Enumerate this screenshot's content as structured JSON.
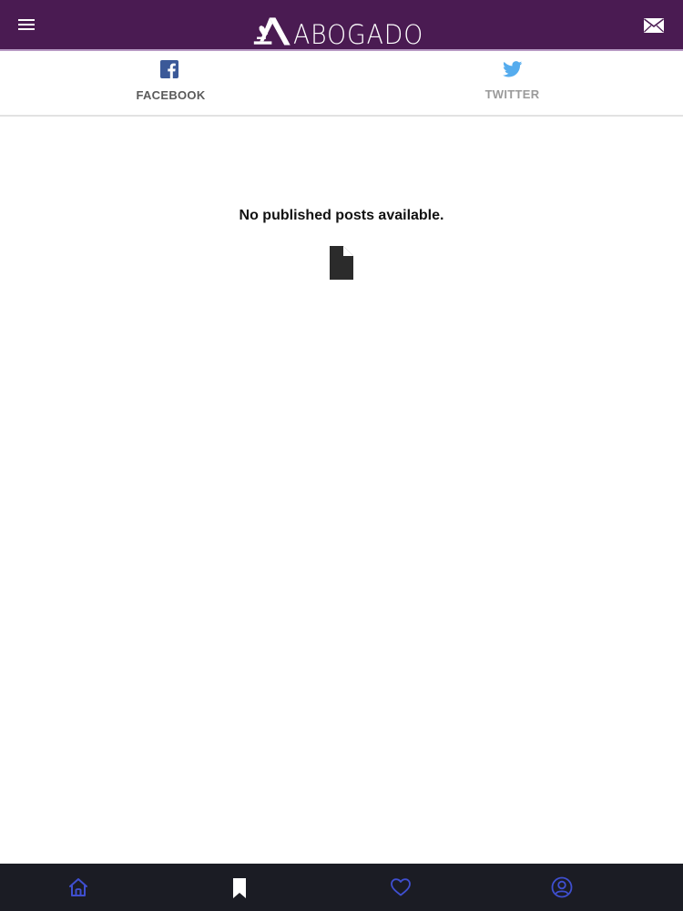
{
  "header": {
    "brand_name": "ABOGADO",
    "icons": [
      "menu-icon",
      "brand-logo",
      "mail-icon"
    ],
    "background_color": "#4a1b52"
  },
  "tabs": [
    {
      "label": "FACEBOOK",
      "icon": "facebook-icon",
      "active": true
    },
    {
      "label": "TWITTER",
      "icon": "twitter-icon",
      "active": false
    }
  ],
  "main": {
    "empty_message": "No published posts available.",
    "empty_icon": "document-icon"
  },
  "bottom_nav": {
    "items": [
      {
        "icon": "home-icon",
        "active": true
      },
      {
        "icon": "bookmark-icon",
        "active": false
      },
      {
        "icon": "heart-icon",
        "active": false
      },
      {
        "icon": "profile-icon",
        "active": false
      }
    ],
    "active_color": "#3f4fd0",
    "background_color": "#1b1c24"
  }
}
